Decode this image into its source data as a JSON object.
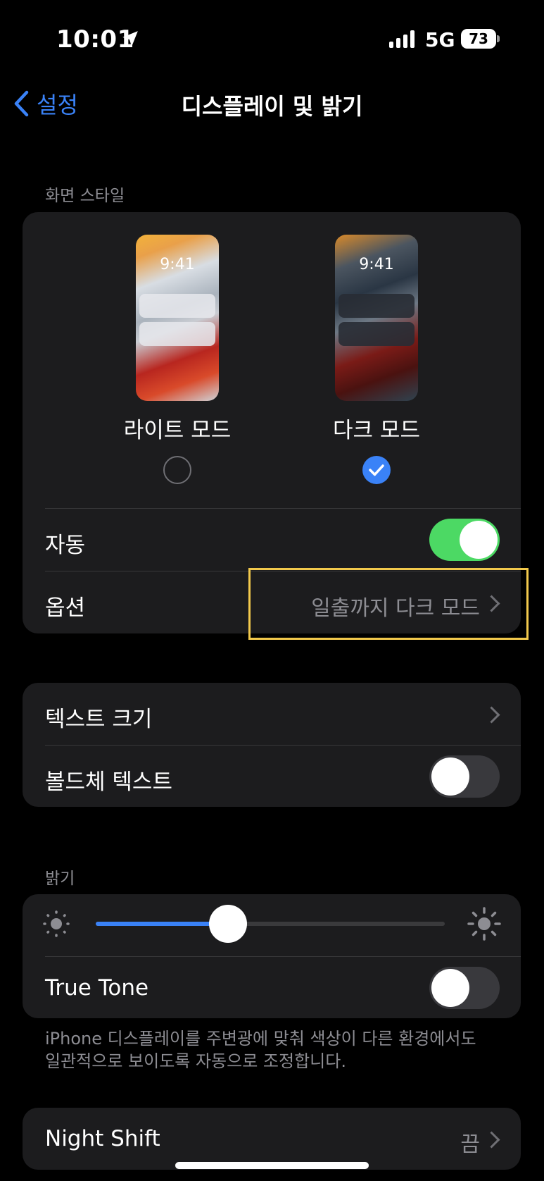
{
  "status_bar": {
    "time": "10:01",
    "network": "5G",
    "battery": "73"
  },
  "nav": {
    "back_label": "설정",
    "title": "디스플레이 및 밝기"
  },
  "appearance": {
    "header": "화면 스타일",
    "light": {
      "preview_time": "9:41",
      "label": "라이트 모드",
      "selected": false
    },
    "dark": {
      "preview_time": "9:41",
      "label": "다크 모드",
      "selected": true
    },
    "automatic": {
      "label": "자동",
      "on": true
    },
    "options": {
      "label": "옵션",
      "value": "일출까지 다크 모드"
    }
  },
  "text": {
    "text_size": {
      "label": "텍스트 크기"
    },
    "bold_text": {
      "label": "볼드체 텍스트",
      "on": false
    }
  },
  "brightness": {
    "header": "밝기",
    "level": 0.38,
    "true_tone": {
      "label": "True Tone",
      "on": false
    },
    "footnote": "iPhone 디스플레이를 주변광에 맞춰 색상이 다른 환경에서도 일관적으로 보이도록 자동으로 조정합니다."
  },
  "night_shift": {
    "label": "Night Shift",
    "value": "끔"
  },
  "colors": {
    "accent": "#3a82f7",
    "toggle_on": "#4cd964",
    "toggle_off": "#39393d",
    "highlight": "#f2c94c"
  }
}
